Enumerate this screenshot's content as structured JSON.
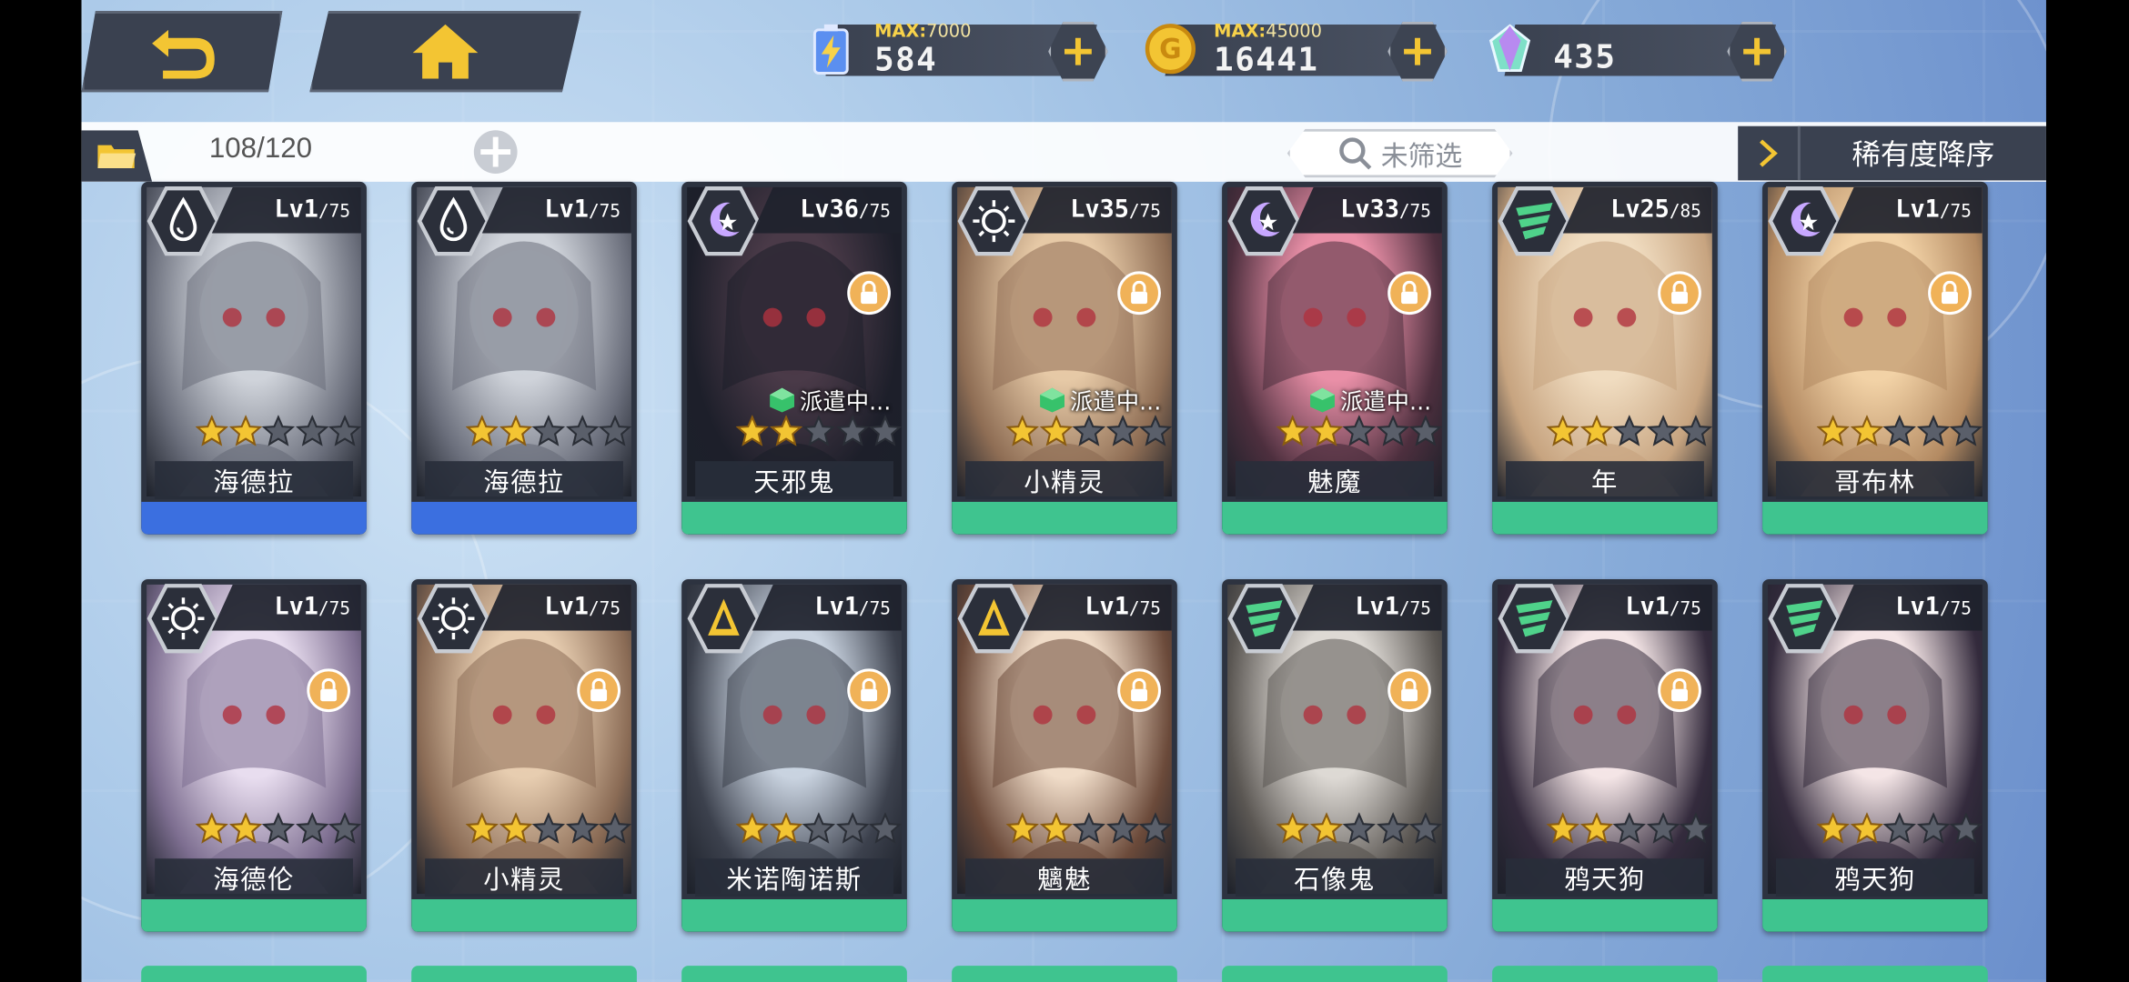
{
  "topbar": {
    "back_icon": "back-arrow-icon",
    "home_icon": "home-icon",
    "resources": [
      {
        "id": "energy",
        "icon": "energy-battery-icon",
        "max_label": "MAX:",
        "max_value": "7000",
        "value": "584"
      },
      {
        "id": "gold",
        "icon": "gold-coin-icon",
        "max_label": "MAX:",
        "max_value": "45000",
        "value": "16441"
      },
      {
        "id": "gem",
        "icon": "crystal-gem-icon",
        "max_label": "",
        "max_value": "",
        "value": "435"
      }
    ]
  },
  "inventory": {
    "count": "108/120",
    "filter_label": "未筛选",
    "sort_label": "稀有度降序"
  },
  "colors": {
    "water_frame": "#3b6fe0",
    "green_frame": "#3fc48f",
    "star": "#f3c533",
    "lock": "#f0b258"
  },
  "cards": [
    {
      "name": "海德拉",
      "level": "Lv1",
      "max": "/75",
      "element": "water",
      "stars": 2,
      "locked": false,
      "dispatch": "",
      "frame": "blue"
    },
    {
      "name": "海德拉",
      "level": "Lv1",
      "max": "/75",
      "element": "water",
      "stars": 2,
      "locked": false,
      "dispatch": "",
      "frame": "blue"
    },
    {
      "name": "天邪鬼",
      "level": "Lv36",
      "max": "/75",
      "element": "moon",
      "stars": 2,
      "locked": true,
      "dispatch": "派遣中...",
      "frame": "green"
    },
    {
      "name": "小精灵",
      "level": "Lv35",
      "max": "/75",
      "element": "sun",
      "stars": 2,
      "locked": true,
      "dispatch": "派遣中...",
      "frame": "green"
    },
    {
      "name": "魅魔",
      "level": "Lv33",
      "max": "/75",
      "element": "moon",
      "stars": 2,
      "locked": true,
      "dispatch": "派遣中...",
      "frame": "green"
    },
    {
      "name": "年",
      "level": "Lv25",
      "max": "/85",
      "element": "wind",
      "stars": 2,
      "locked": true,
      "dispatch": "",
      "frame": "green"
    },
    {
      "name": "哥布林",
      "level": "Lv1",
      "max": "/75",
      "element": "moon",
      "stars": 2,
      "locked": true,
      "dispatch": "",
      "frame": "green"
    },
    {
      "name": "海德伦",
      "level": "Lv1",
      "max": "/75",
      "element": "sun",
      "stars": 2,
      "locked": true,
      "dispatch": "",
      "frame": "green"
    },
    {
      "name": "小精灵",
      "level": "Lv1",
      "max": "/75",
      "element": "sun",
      "stars": 2,
      "locked": true,
      "dispatch": "",
      "frame": "green"
    },
    {
      "name": "米诺陶诺斯",
      "level": "Lv1",
      "max": "/75",
      "element": "earth",
      "stars": 2,
      "locked": true,
      "dispatch": "",
      "frame": "green"
    },
    {
      "name": "魑魅",
      "level": "Lv1",
      "max": "/75",
      "element": "earth",
      "stars": 2,
      "locked": true,
      "dispatch": "",
      "frame": "green"
    },
    {
      "name": "石像鬼",
      "level": "Lv1",
      "max": "/75",
      "element": "wind",
      "stars": 2,
      "locked": true,
      "dispatch": "",
      "frame": "green"
    },
    {
      "name": "鸦天狗",
      "level": "Lv1",
      "max": "/75",
      "element": "wind",
      "stars": 2,
      "locked": true,
      "dispatch": "",
      "frame": "green"
    },
    {
      "name": "鸦天狗",
      "level": "Lv1",
      "max": "/75",
      "element": "wind",
      "stars": 2,
      "locked": false,
      "dispatch": "",
      "frame": "green"
    }
  ]
}
